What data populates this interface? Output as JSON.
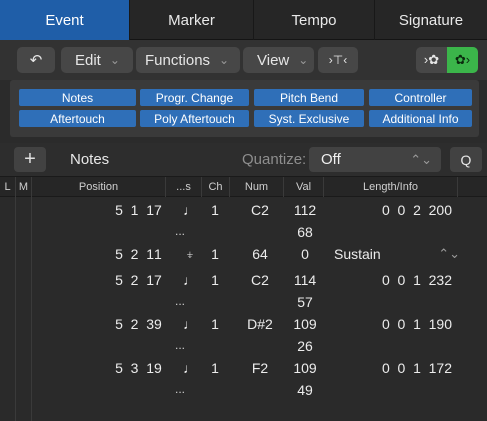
{
  "tabs": [
    "Event",
    "Marker",
    "Tempo",
    "Signature"
  ],
  "toolbar": {
    "back_icon": "↶",
    "edit": "Edit",
    "functions": "Functions",
    "view": "View",
    "chevron": "⌄",
    "filter_icon": "›⊤‹",
    "midi_in_icon": "›✿",
    "midi_out_icon": "✿›"
  },
  "filters": {
    "notes": "Notes",
    "progr_change": "Progr. Change",
    "pitch_bend": "Pitch Bend",
    "controller": "Controller",
    "aftertouch": "Aftertouch",
    "poly_aftertouch": "Poly Aftertouch",
    "syst_exclusive": "Syst. Exclusive",
    "additional_info": "Additional Info"
  },
  "notes_bar": {
    "plus": "+",
    "label": "Notes",
    "quantize_label": "Quantize:",
    "quantize_value": "Off",
    "updown": "⌃⌄",
    "q": "Q"
  },
  "columns": {
    "l": "L",
    "m": "M",
    "position": "Position",
    "status": "...s",
    "ch": "Ch",
    "num": "Num",
    "val": "Val",
    "length": "Length/Info"
  },
  "rows": [
    {
      "pos": "5  1  1",
      "sub": "7",
      "type": "♩",
      "ch": "1",
      "num": "C2",
      "val": "112",
      "val2": "68",
      "len": "0  0  2  200",
      "dots": "..."
    },
    {
      "pos": "5  2  1",
      "sub": "1",
      "type": "⍖",
      "ch": "1",
      "num": "64",
      "val": "0",
      "info": "Sustain"
    },
    {
      "pos": "5  2  1",
      "sub": "7",
      "type": "♩",
      "ch": "1",
      "num": "C2",
      "val": "114",
      "val2": "57",
      "len": "0  0  1  232",
      "dots": "..."
    },
    {
      "pos": "5  2  3",
      "sub": "9",
      "type": "♩",
      "ch": "1",
      "num": "D#2",
      "val": "109",
      "val2": "26",
      "len": "0  0  1  190",
      "dots": "..."
    },
    {
      "pos": "5  3  1",
      "sub": "9",
      "type": "♩",
      "ch": "1",
      "num": "F2",
      "val": "109",
      "val2": "49",
      "len": "0  0  1  172",
      "dots": "..."
    }
  ]
}
